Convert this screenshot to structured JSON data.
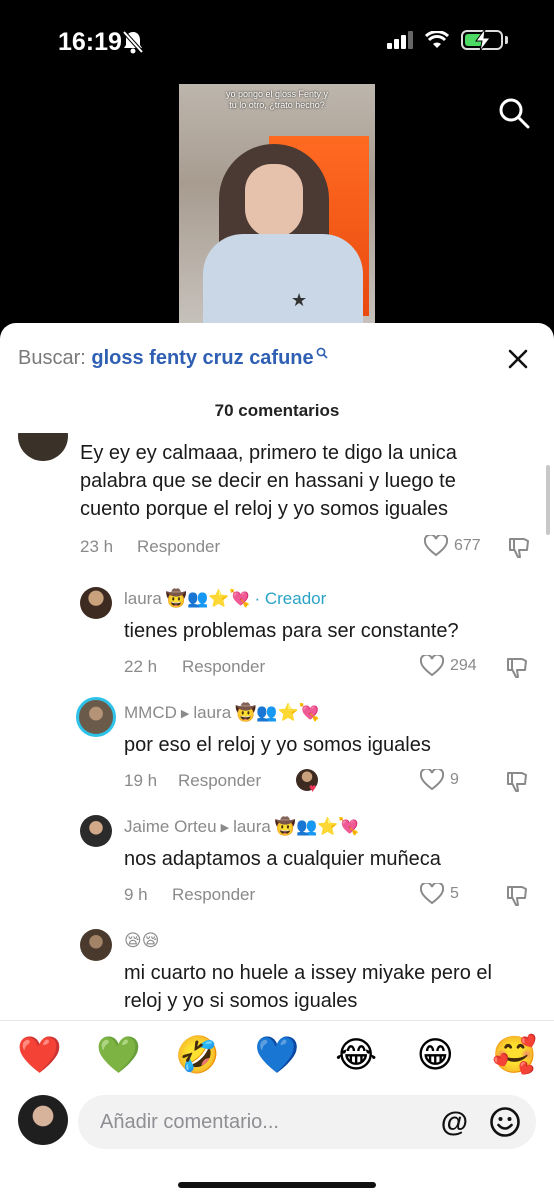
{
  "status": {
    "time": "16:19"
  },
  "video": {
    "caption": "yo pongo el gloss Fenty y\ntu lo otro, ¿trato hecho?"
  },
  "sheet": {
    "search_label": "Buscar:",
    "search_query": "gloss fenty cruz cafune",
    "count": "70 comentarios"
  },
  "comments": [
    {
      "text": "Ey ey ey calmaaa, primero te digo la unica\npalabra que se decir en hassani y luego te\ncuento porque el reloj y yo somos iguales",
      "time": "23 h",
      "reply": "Responder",
      "likes": "677"
    },
    {
      "author": "laura",
      "author_emojis": "🤠👥⭐💘",
      "creator": "· Creador",
      "text": "tienes problemas para ser constante?",
      "time": "22 h",
      "reply": "Responder",
      "likes": "294"
    },
    {
      "author": "MMCD",
      "reply_to": "laura",
      "reply_to_emojis": "🤠👥⭐💘",
      "text": "por eso el reloj y yo somos iguales",
      "time": "19 h",
      "reply": "Responder",
      "likes": "9"
    },
    {
      "author": "Jaime Orteu",
      "reply_to": "laura",
      "reply_to_emojis": "🤠👥⭐💘",
      "text": "nos adaptamos a cualquier muñeca",
      "time": "9 h",
      "reply": "Responder",
      "likes": "5"
    },
    {
      "author_emojis": "😪😪",
      "text": "mi cuarto no huele a issey miyake pero el\nreloj y yo si somos iguales"
    }
  ],
  "emoji_bar": [
    "❤️",
    "💚",
    "🤣",
    "💙",
    "😂",
    "😁",
    "🥰"
  ],
  "input": {
    "placeholder": "Añadir comentario..."
  },
  "colors": {
    "accent": "#2f5fb3",
    "creator": "#2ba3c6",
    "battery": "#4cd964"
  },
  "icons": [
    "bell-off-icon",
    "signal-icon",
    "wifi-icon",
    "battery-icon",
    "search-icon",
    "close-icon",
    "heart-icon",
    "dislike-icon",
    "at-icon",
    "smile-icon"
  ]
}
